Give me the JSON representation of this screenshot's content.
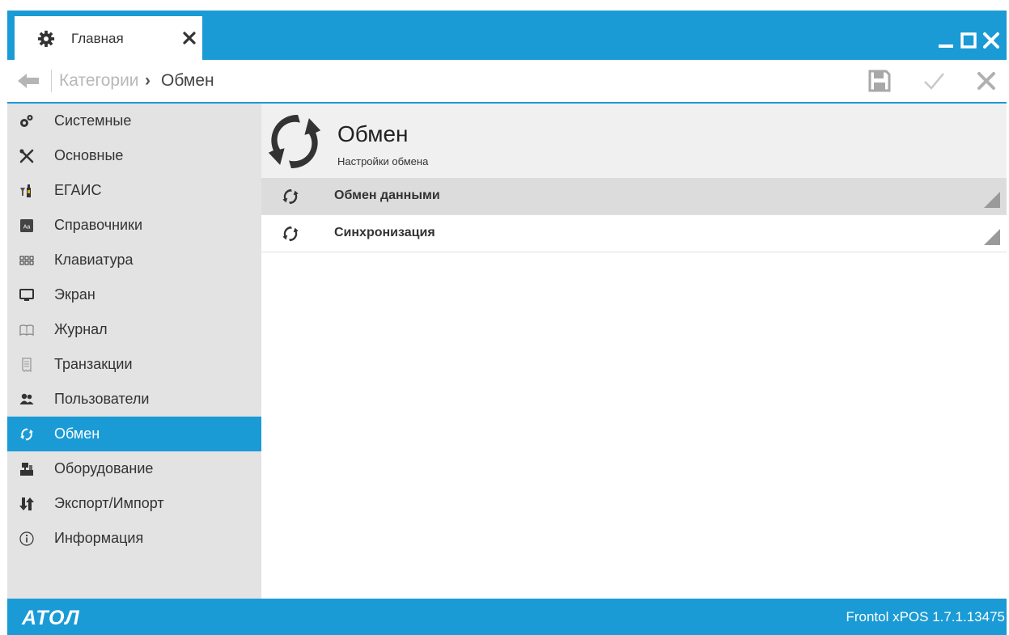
{
  "window": {
    "tab_label": "Главная",
    "controls": [
      "minimize-icon",
      "maximize-icon",
      "close-icon"
    ]
  },
  "breadcrumb": {
    "root": "Категории",
    "separator": "›",
    "current": "Обмен"
  },
  "toolbar": {
    "buttons": [
      "save-icon",
      "apply-check-icon",
      "cancel-x-icon"
    ]
  },
  "sidebar": {
    "items": [
      {
        "label": "Системные",
        "icon": "gears-icon"
      },
      {
        "label": "Основные",
        "icon": "tools-icon"
      },
      {
        "label": "ЕГАИС",
        "icon": "bottles-icon"
      },
      {
        "label": "Справочники",
        "icon": "dictionary-icon"
      },
      {
        "label": "Клавиатура",
        "icon": "keyboard-icon"
      },
      {
        "label": "Экран",
        "icon": "monitor-icon"
      },
      {
        "label": "Журнал",
        "icon": "journal-icon"
      },
      {
        "label": "Транзакции",
        "icon": "receipt-icon"
      },
      {
        "label": "Пользователи",
        "icon": "users-icon"
      },
      {
        "label": "Обмен",
        "icon": "sync-icon",
        "active": true
      },
      {
        "label": "Оборудование",
        "icon": "cash-register-icon"
      },
      {
        "label": "Экспорт/Импорт",
        "icon": "export-import-icon"
      },
      {
        "label": "Информация",
        "icon": "info-icon"
      }
    ]
  },
  "main": {
    "title": "Обмен",
    "subtitle": "Настройки обмена",
    "rows": [
      {
        "label": "Обмен данными",
        "icon": "sync-icon",
        "expanded": true
      },
      {
        "label": "Синхронизация",
        "icon": "sync-icon",
        "expanded": false
      }
    ]
  },
  "status": {
    "logo": "ATOЛ",
    "version": "Frontol xPOS 1.7.1.13475"
  },
  "colors": {
    "accent": "#1a9bd5",
    "sidebar_bg": "#e3e3e3",
    "header_bg": "#f0f0f0",
    "expanded_row_bg": "#dcdcdc"
  }
}
